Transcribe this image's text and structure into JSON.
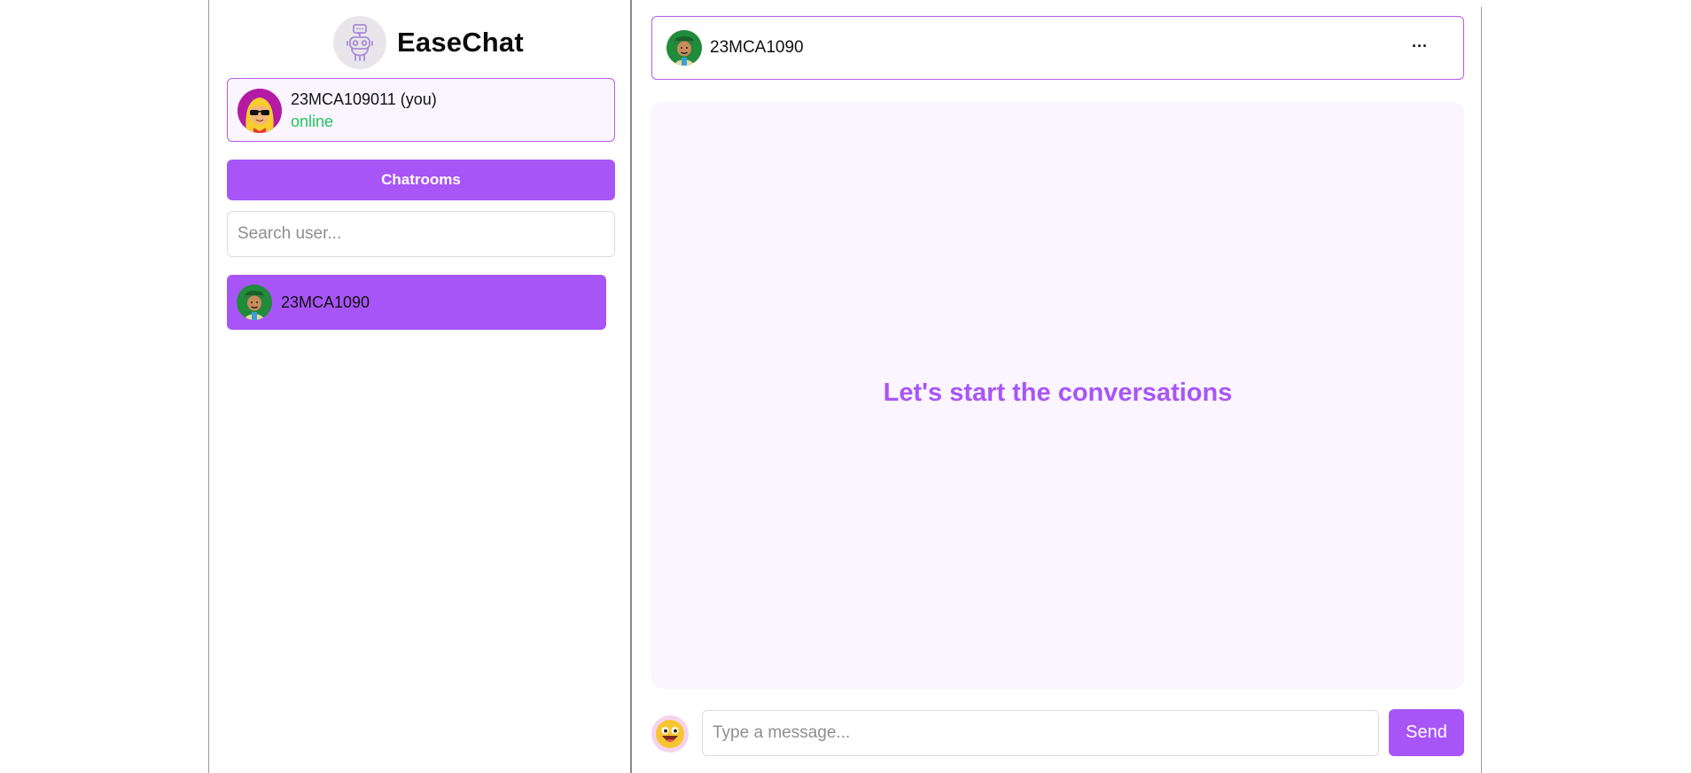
{
  "brand": {
    "name": "EaseChat",
    "logo_icon": "robot-chat-icon"
  },
  "current_user": {
    "name": "23MCA109011 (you)",
    "status": "online",
    "status_color": "#22c55e",
    "avatar_icon": "avatar-blonde-sunglasses-icon"
  },
  "sidebar": {
    "chatrooms_label": "Chatrooms",
    "search_placeholder": "Search user...",
    "users": [
      {
        "name": "23MCA1090",
        "avatar_icon": "avatar-green-cap-icon",
        "selected": true
      }
    ]
  },
  "chat": {
    "header": {
      "name": "23MCA1090",
      "more_label": "..."
    },
    "empty_message": "Let's start the conversations",
    "composer": {
      "placeholder": "Type a message...",
      "send_label": "Send",
      "emoji_icon": "emoji-face-icon"
    }
  },
  "colors": {
    "accent": "#a855f7",
    "panel_bg": "#faf5ff",
    "border_accent": "#b65be8"
  }
}
